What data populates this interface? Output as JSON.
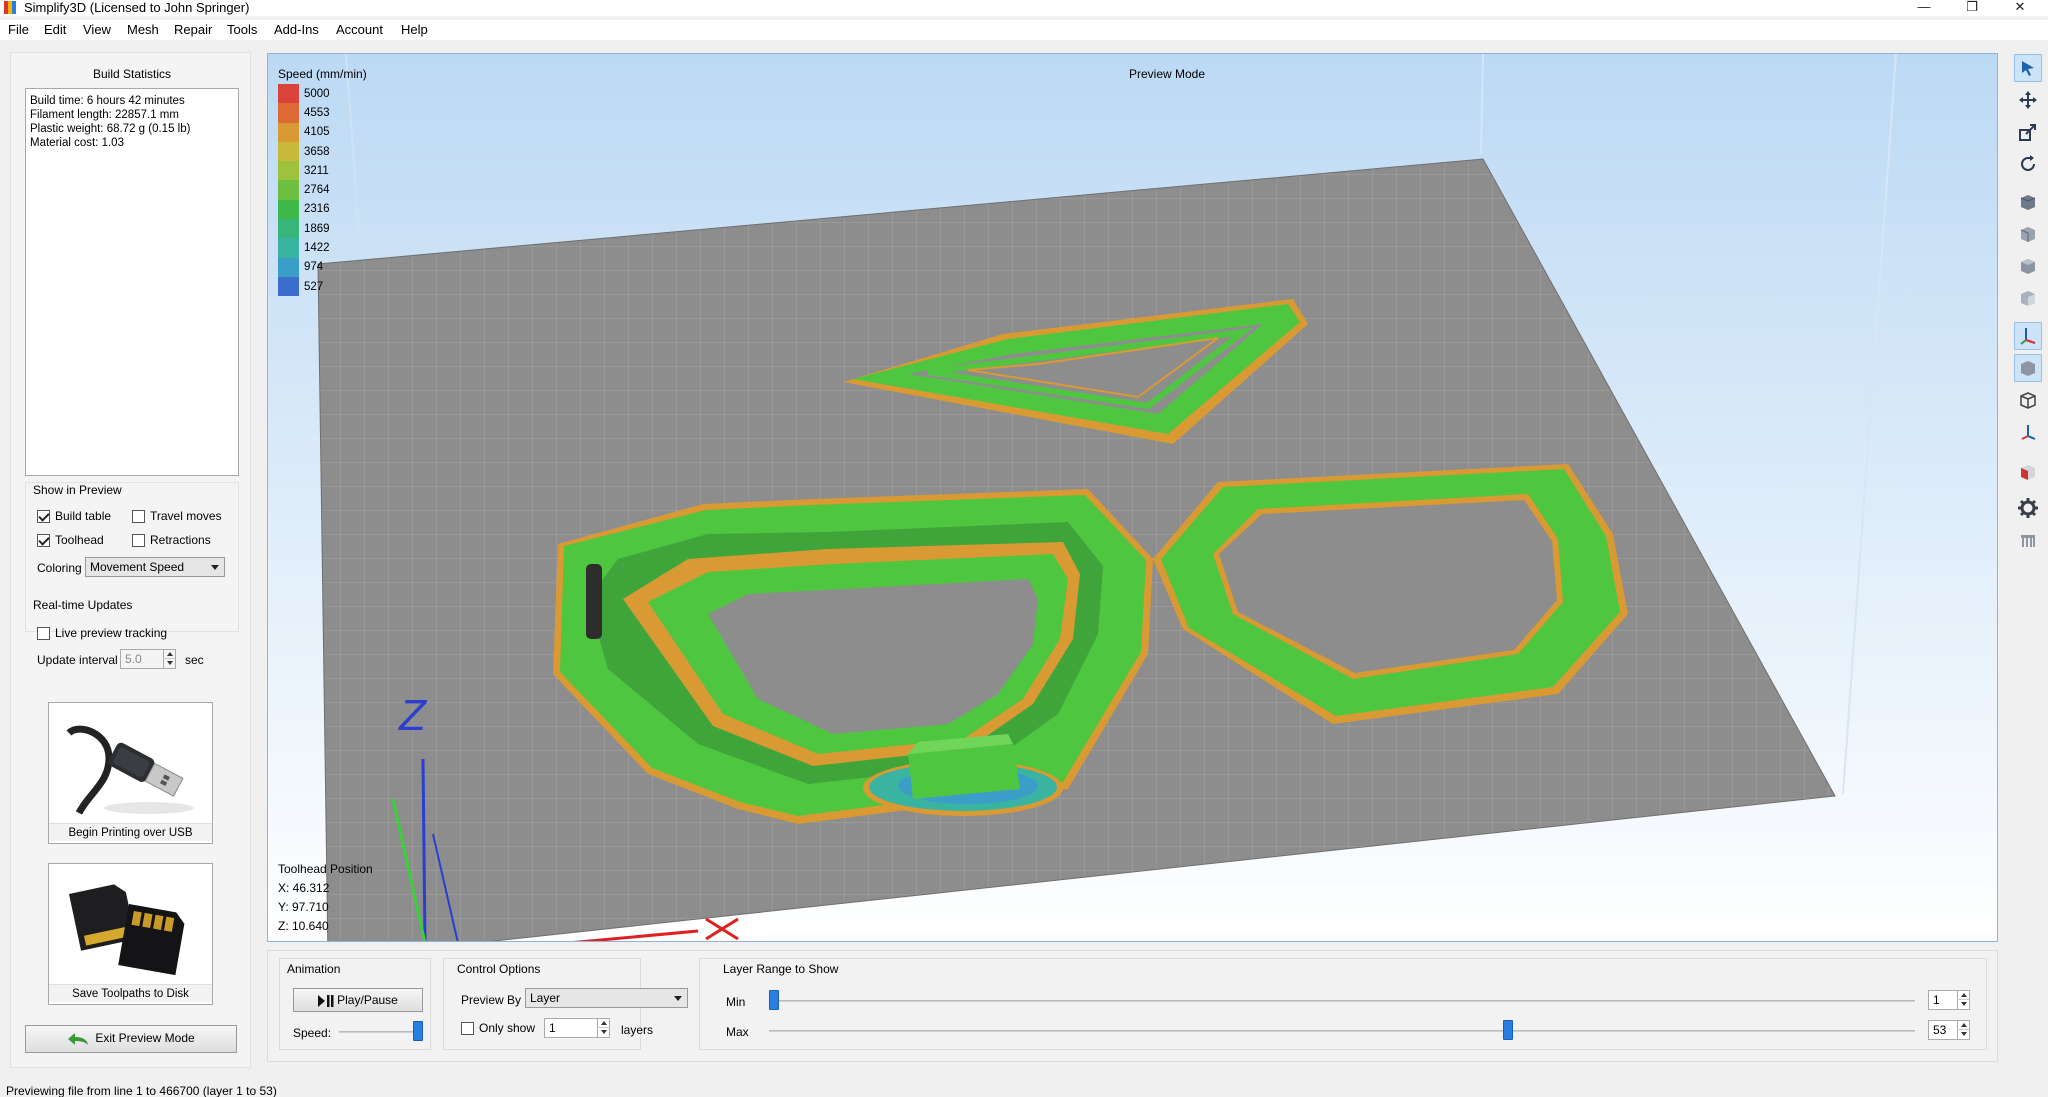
{
  "window": {
    "title": "Simplify3D (Licensed to John Springer)",
    "minimize": "—",
    "restore": "❐",
    "close": "✕"
  },
  "menu": [
    "File",
    "Edit",
    "View",
    "Mesh",
    "Repair",
    "Tools",
    "Add-Ins",
    "Account",
    "Help"
  ],
  "build_statistics": {
    "title": "Build Statistics",
    "lines": [
      "Build time: 6 hours 42 minutes",
      "Filament length: 22857.1 mm",
      "Plastic weight: 68.72 g (0.15 lb)",
      "Material cost: 1.03"
    ]
  },
  "show_in_preview": {
    "title": "Show in Preview",
    "build_table": "Build table",
    "travel_moves": "Travel moves",
    "toolhead": "Toolhead",
    "retractions": "Retractions",
    "build_table_checked": true,
    "toolhead_checked": true,
    "travel_moves_checked": false,
    "retractions_checked": false,
    "coloring_label": "Coloring",
    "coloring_value": "Movement Speed"
  },
  "realtime": {
    "title": "Real-time Updates",
    "live_tracking": "Live preview tracking",
    "update_interval_label": "Update interval",
    "update_interval_value": "5.0",
    "unit": "sec"
  },
  "cards": {
    "usb": "Begin Printing over USB",
    "disk": "Save Toolpaths to Disk"
  },
  "exit_button": "Exit Preview Mode",
  "viewport": {
    "mode_label": "Preview Mode",
    "legend_title": "Speed (mm/min)",
    "legend": [
      {
        "value": "5000",
        "color": "#d9433a"
      },
      {
        "value": "4553",
        "color": "#dd6a34"
      },
      {
        "value": "4105",
        "color": "#d99a34"
      },
      {
        "value": "3658",
        "color": "#c7b93a"
      },
      {
        "value": "3211",
        "color": "#9fc23c"
      },
      {
        "value": "2764",
        "color": "#6fbf42"
      },
      {
        "value": "2316",
        "color": "#3fb84a"
      },
      {
        "value": "1869",
        "color": "#36b678"
      },
      {
        "value": "1422",
        "color": "#38b4a0"
      },
      {
        "value": "974",
        "color": "#3a9ec8"
      },
      {
        "value": "527",
        "color": "#3c6fcc"
      }
    ],
    "toolhead_title": "Toolhead Position",
    "x": "X: 46.312",
    "y": "Y: 97.710",
    "z": "Z: 10.640",
    "axis_z": "Z"
  },
  "animation": {
    "title": "Animation",
    "play_pause": "Play/Pause",
    "speed_label": "Speed:",
    "speed_level": 1.0
  },
  "control_options": {
    "title": "Control Options",
    "preview_by_label": "Preview By",
    "preview_by_value": "Layer",
    "only_show": "Only show",
    "only_show_value": "1",
    "layers_unit": "layers"
  },
  "layer_range": {
    "title": "Layer Range to Show",
    "min_label": "Min",
    "max_label": "Max",
    "min_value": "1",
    "max_value": "53",
    "min_fraction": 0.0,
    "max_fraction": 0.646
  },
  "status": "Previewing file from line 1 to 466700 (layer 1 to 53)"
}
